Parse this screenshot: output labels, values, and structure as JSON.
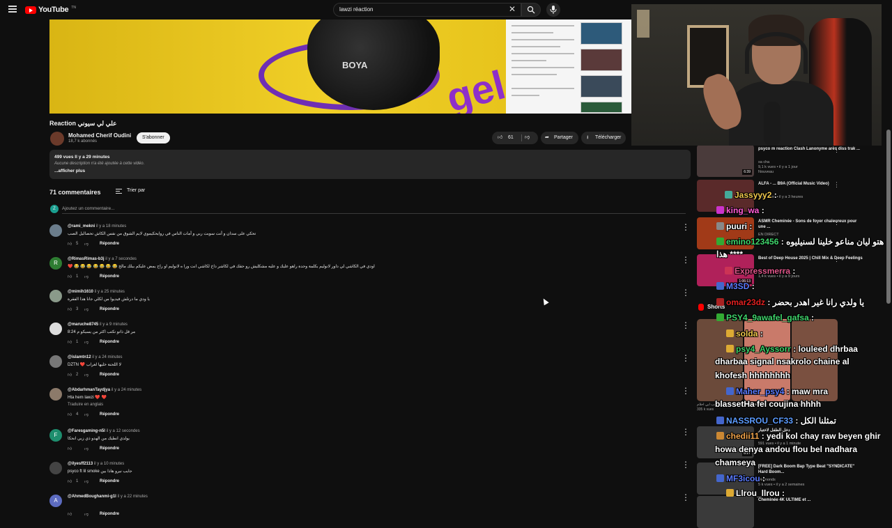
{
  "header": {
    "logo_text": "YouTube",
    "logo_country": "TN",
    "search_value": "lawzi réaction"
  },
  "video": {
    "title": "Reaction علي لي سيوني",
    "brand_text": "BOYA",
    "overlay_word": "gel"
  },
  "channel": {
    "name": "Mohamed Cherif Oudini",
    "subscribers": "18,7 k abonnés",
    "subscribe_label": "S'abonner"
  },
  "actions": {
    "likes": "61",
    "share_label": "Partager",
    "download_label": "Télécharger"
  },
  "description": {
    "stats": "499 vues  Il y a 29 minutes",
    "text": "Aucune description n'a été ajoutée à cette vidéo.",
    "more": "...afficher plus"
  },
  "comments_section": {
    "count_label": "71 commentaires",
    "sort_label": "Trier par",
    "add_placeholder": "Ajoutez un commentaire...",
    "add_avatar_letter": "Z",
    "reply_label": "Répondre"
  },
  "comments": [
    {
      "author": "@rami_mekni",
      "time": "il y a 18 minutes",
      "text": "تحكي على سدان و أنت سوبت ربي و أمات الناس في روايحكيموي لايم الشوق من نفس الكاش تحصاليل الصب",
      "extra": "",
      "likes": "5",
      "avatar_letter": "",
      "avatar_color": "#6b7d8c"
    },
    {
      "author": "@RimasRimas-b3j",
      "time": "il y a 7 secondes",
      "text": "❤️ 😂 😂 😂 😂 😂 😂 😂 اودي في الكاشي لي داور لانوليم بكلمة وحدة راهو عليك و عليه مشكليش رو حقك في لكاشر داخ لكاشي انت ورا ه لانوليم او راح يمض عليكم ببلك مالخ",
      "extra": "",
      "likes": "1",
      "avatar_letter": "R",
      "avatar_color": "#2e7d32"
    },
    {
      "author": "@mimih1610",
      "time": "il y a 25 minutes",
      "text": "يا ودي ما درتلش فيديوا من لكلي جانا هذا الفقرة",
      "extra": "",
      "likes": "3",
      "avatar_letter": "",
      "avatar_color": "#8a9a8a"
    },
    {
      "author": "@maruche8745",
      "time": "il y a 9 minutes",
      "text": "8:24 مر قل ذاتو تكتب اكثر من يسيكو م",
      "extra": "",
      "likes": "1",
      "avatar_letter": "",
      "avatar_color": "#dddddd"
    },
    {
      "author": "@islamtn12",
      "time": "il y a 24 minutes",
      "text": "DZTN ❤️ لا اللحنة خليها لغراب",
      "extra": "",
      "likes": "2",
      "avatar_letter": "",
      "avatar_color": "#777777"
    },
    {
      "author": "@AbdarhmanTaydjya",
      "time": "il y a 24 minutes",
      "text": "Hta hem lawzi ❤️ ❤️",
      "extra": "Traduire en anglais",
      "likes": "4",
      "avatar_letter": "",
      "avatar_color": "#8c7a6a"
    },
    {
      "author": "@Faresgaming-n5l",
      "time": "il y a 12 secondes",
      "text": "يولدي انطيك من الهدو ذي زبي انحكا",
      "extra": "",
      "likes": "",
      "avatar_letter": "F",
      "avatar_color": "#1e8e6e"
    },
    {
      "author": "@ilyesff2113",
      "time": "il y a 10 minutes",
      "text": "psyco ft lil smoke جايب نيرو هاذا بين",
      "extra": "",
      "likes": "1",
      "avatar_letter": "",
      "avatar_color": "#444444"
    },
    {
      "author": "@AhmedBoughanmi-g1l",
      "time": "il y a 22 minutes",
      "text": "",
      "extra": "",
      "likes": "",
      "avatar_letter": "A",
      "avatar_color": "#5c6bc0"
    }
  ],
  "recommendations": [
    {
      "title": "psyco m reaction Clash Lanonyme arès diss trak ...",
      "channel": "sa cha",
      "meta": "9,1 k vues • il y a 1 jour",
      "badge": "Nouveau",
      "duration": "6:39",
      "thumb_color": "#4a3b3b"
    },
    {
      "title": "ALFA - ... B9A (Official Music Video)",
      "channel": "",
      "meta": "1,7 k vues • il y a 3 heures",
      "badge": "",
      "duration": "",
      "thumb_color": "#5a2a2a"
    },
    {
      "title": "ASMR Cheminée - Sons de foyer chaleureux pour une ...",
      "channel": "",
      "meta": "EN DIRECT",
      "badge": "",
      "duration": "",
      "thumb_color": "#a13a18"
    },
    {
      "title": "Best of Deep House 2025 | Chill Mix & Deep Feelings",
      "channel": "DEEPLE PLANET",
      "meta": "1,4 k vues • il y a 9 jours",
      "badge": "",
      "duration": "1:06:13",
      "thumb_color": "#b0215a"
    }
  ],
  "shorts": {
    "label": "Shorts",
    "items": [
      {
        "meta": "335 k vues",
        "caption": "إاسحب ابي احلام",
        "color": "#6b4a3a"
      },
      {
        "meta": "74 k vues",
        "caption": "",
        "color": "#c97a6a"
      },
      {
        "meta": "52 k vues",
        "caption": "",
        "color": "#7a5040"
      }
    ]
  },
  "more_recs": [
    {
      "title": "دخل الطفل لاختبار",
      "meta": "591 vues • il y a 1 minute",
      "duration": "8:27"
    },
    {
      "title": "[FREE] Dark Boom Bap Type Beat \"SYNDICATE\" Hard Boom...",
      "meta": "5 k vues • il y a 2 semaines",
      "channel": "Diamonds"
    },
    {
      "title": "Cheminée 4K ULTIME et ...",
      "meta": ""
    }
  ],
  "chat": [
    {
      "user": "Jassyyy2",
      "msg": ":",
      "color": "#f2c94c"
    },
    {
      "user": "king_wa",
      "msg": ":",
      "color": "#ff5cd6"
    },
    {
      "user": "puuri",
      "msg": ":",
      "color": "#ffffff"
    },
    {
      "user": "emino123456",
      "msg": ": هتو ليان مناعو خلينا لسنيليوه",
      "color": "#3fd46b"
    },
    {
      "user": "",
      "msg": "هذا ****",
      "color": "#ffffff"
    },
    {
      "user": "Expressmerra",
      "msg": ":",
      "color": "#e0568a"
    },
    {
      "user": "M3SD",
      "msg": ":",
      "color": "#5c7cff"
    },
    {
      "user": "omar23dz",
      "msg": ": يا ولدي رانا غير اهدر بحضر",
      "color": "#e02020"
    },
    {
      "user": "PSY4_9awafel_gafsa",
      "msg": ":",
      "color": "#3fd46b"
    },
    {
      "user": "solda",
      "msg": ":",
      "color": "#f2c94c"
    },
    {
      "user": "psy4_Ayssorr",
      "msg": ": louleed dhrbaa",
      "color": "#3fd46b"
    },
    {
      "user": "",
      "msg": "dharbaa signal nsakrolo chaine al",
      "color": "#ffffff"
    },
    {
      "user": "",
      "msg": "khofesh hhhhhhhh",
      "color": "#ffffff"
    },
    {
      "user": "Maher_psy4",
      "msg": ": maw mra",
      "color": "#5c7cff"
    },
    {
      "user": "",
      "msg": "blassetHa fel coujina hhhh",
      "color": "#ffffff"
    },
    {
      "user": "NASSROU_CF33",
      "msg": ": تمثلنا الكل",
      "color": "#5c9cff"
    },
    {
      "user": "chedii11",
      "msg": ": yedi kol chay raw beyen ghir",
      "color": "#f2a54c"
    },
    {
      "user": "",
      "msg": "howa denya andou flou bel nadhara",
      "color": "#ffffff"
    },
    {
      "user": "",
      "msg": "chamseya",
      "color": "#ffffff"
    },
    {
      "user": "MF3icou",
      "msg": ":",
      "color": "#5c7cff"
    },
    {
      "user": "Llrou_llrou",
      "msg": ":",
      "color": "#ffffff"
    }
  ]
}
